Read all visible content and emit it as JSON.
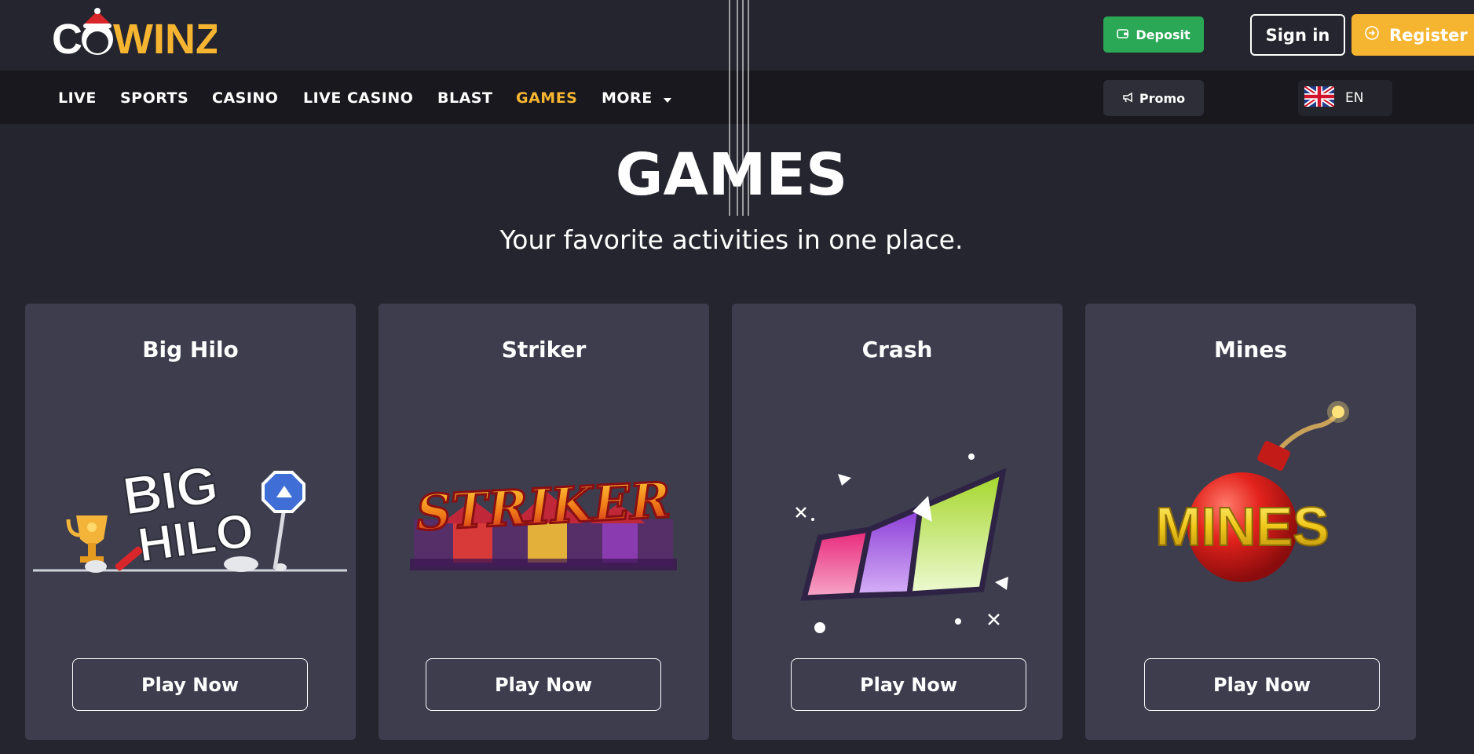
{
  "header": {
    "logo_text": "COWINZ",
    "deposit_label": "Deposit",
    "signin_label": "Sign in",
    "register_label": "Register"
  },
  "nav": {
    "items": [
      "LIVE",
      "SPORTS",
      "CASINO",
      "LIVE CASINO",
      "BLAST",
      "GAMES",
      "MORE"
    ],
    "active": "GAMES",
    "promo_label": "Promo",
    "language": "EN"
  },
  "hero": {
    "title": "GAMES",
    "subtitle": "Your favorite activities in one place."
  },
  "games": [
    {
      "title": "Big Hilo",
      "logo_text": "BIG HILO",
      "button": "Play Now"
    },
    {
      "title": "Striker",
      "logo_text": "STRIKER",
      "button": "Play Now"
    },
    {
      "title": "Crash",
      "button": "Play Now"
    },
    {
      "title": "Mines",
      "logo_text": "MINES",
      "button": "Play Now"
    }
  ],
  "colors": {
    "background": "#25252f",
    "navbar": "#18181e",
    "card": "#3d3d4e",
    "accent": "#f6b531",
    "deposit": "#2aa855"
  }
}
